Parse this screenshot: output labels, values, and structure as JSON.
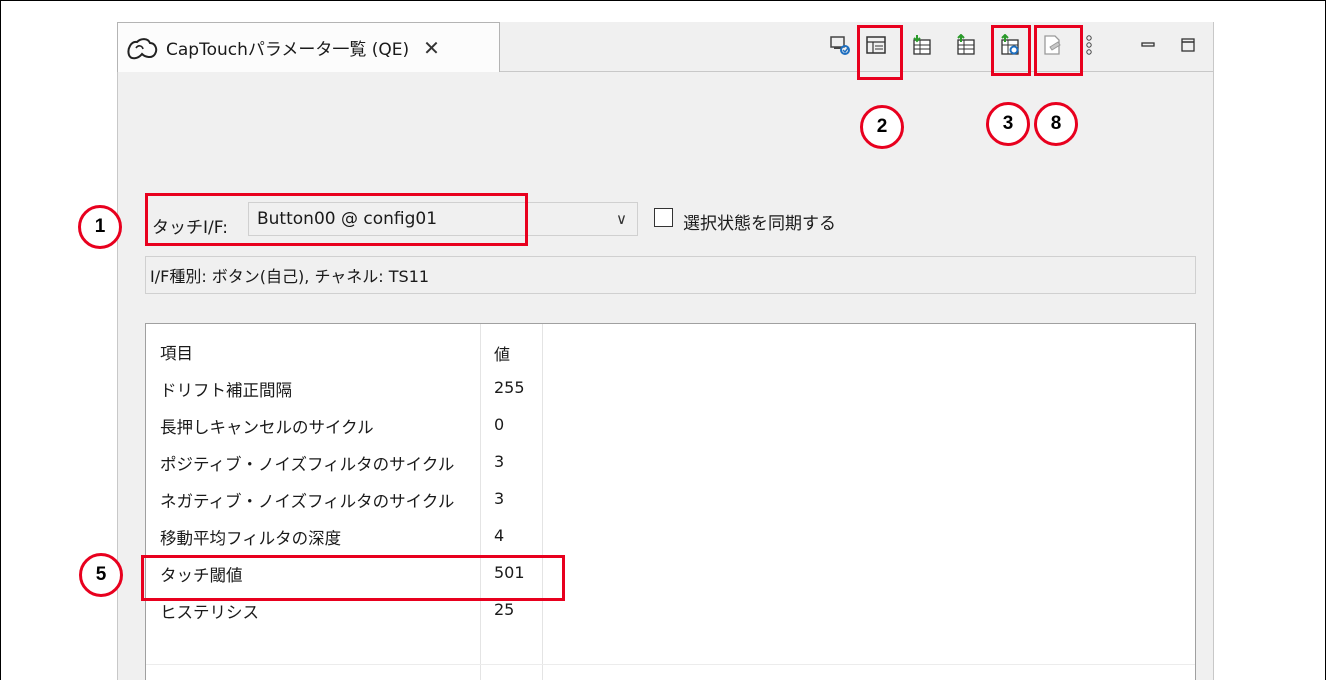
{
  "tab": {
    "title": "CapTouchパラメータ一覧 (QE)",
    "close": "✕"
  },
  "toolbar": {
    "buttons": [
      "select-interface-icon",
      "parameter-list-icon",
      "import-icon",
      "export-icon",
      "write-parameters-icon",
      "output-file-icon",
      "view-menu-icon",
      "minimize-icon",
      "maximize-icon"
    ]
  },
  "touch_if": {
    "label": "タッチI/F:",
    "selected": "Button00 @ config01",
    "arrow": "∨",
    "sync_label": "選択状態を同期する",
    "sync_checked": false
  },
  "info": "I/F種別: ボタン(自己), チャネル: TS11",
  "table": {
    "headers": {
      "item": "項目",
      "value": "値"
    },
    "rows": [
      {
        "item": "ドリフト補正間隔",
        "value": "255"
      },
      {
        "item": "長押しキャンセルのサイクル",
        "value": "0"
      },
      {
        "item": "ポジティブ・ノイズフィルタのサイクル",
        "value": "3"
      },
      {
        "item": "ネガティブ・ノイズフィルタのサイクル",
        "value": "3"
      },
      {
        "item": "移動平均フィルタの深度",
        "value": "4"
      },
      {
        "item": "タッチ閾値",
        "value": "501"
      },
      {
        "item": "ヒステリシス",
        "value": "25"
      }
    ]
  },
  "callouts": [
    "1",
    "2",
    "3",
    "5",
    "8"
  ],
  "colors": {
    "highlight": "#e8001e",
    "panel_bg": "#f0f0f0",
    "icon_green": "#2a9a2a",
    "icon_blue": "#1e6fc0"
  }
}
